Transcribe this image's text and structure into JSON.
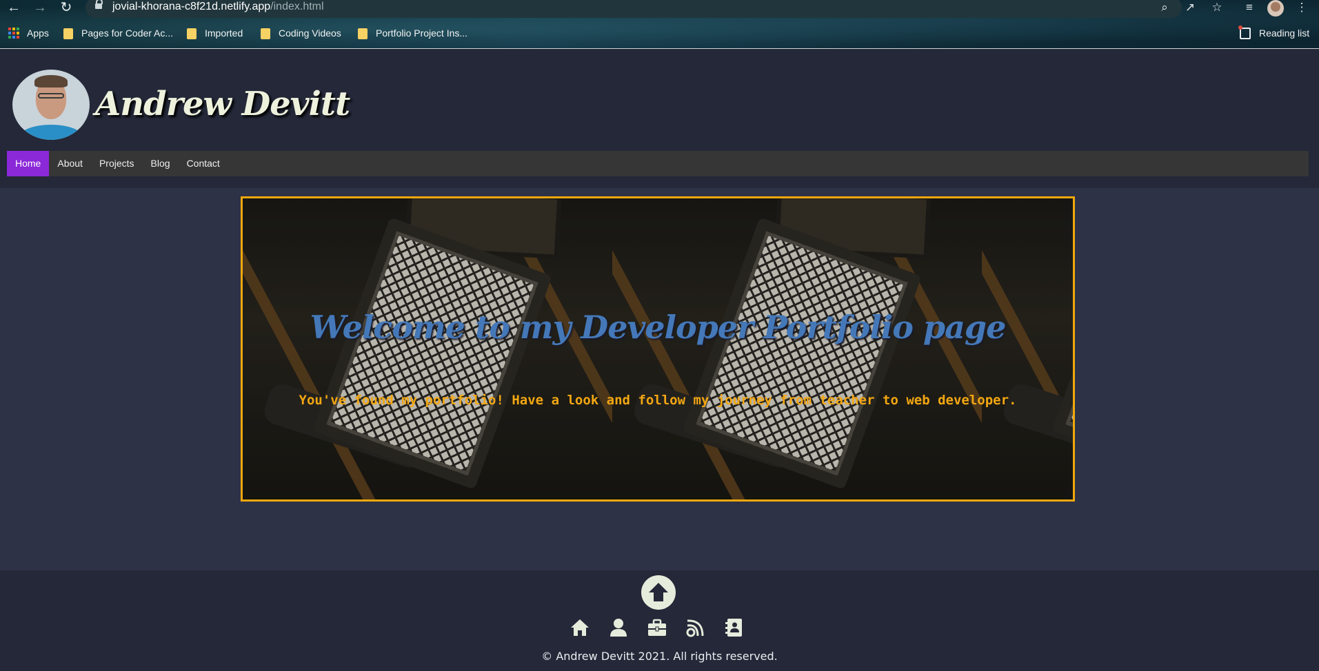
{
  "browser": {
    "url_host": "jovial-khorana-c8f21d.netlify.app",
    "url_path": "/index.html",
    "bookmarks": [
      {
        "label": "Apps"
      },
      {
        "label": "Pages for Coder Ac..."
      },
      {
        "label": "Imported"
      },
      {
        "label": "Coding Videos"
      },
      {
        "label": "Portfolio Project Ins..."
      }
    ],
    "reading_list": "Reading list"
  },
  "header": {
    "site_title": "Andrew Devitt",
    "nav": [
      {
        "label": "Home",
        "active": true
      },
      {
        "label": "About"
      },
      {
        "label": "Projects"
      },
      {
        "label": "Blog"
      },
      {
        "label": "Contact"
      }
    ]
  },
  "hero": {
    "title": "Welcome to my Developer Portfolio page",
    "subtitle": "You've found my portfolio! Have a look and follow my journey from teacher to web developer."
  },
  "footer": {
    "icons": [
      "home-icon",
      "user-icon",
      "briefcase-icon",
      "blog-icon",
      "address-book-icon"
    ],
    "copyright": "© Andrew Devitt 2021. All rights reserved."
  },
  "colors": {
    "page_bg": "#2e3247",
    "header_bg": "#242838",
    "nav_bg": "#363636",
    "nav_active": "#8b28d8",
    "hero_border": "#f0a80c",
    "hero_title": "#4478b8",
    "hero_subtitle": "#f3a712",
    "footer_icon": "#e6ecdc"
  }
}
